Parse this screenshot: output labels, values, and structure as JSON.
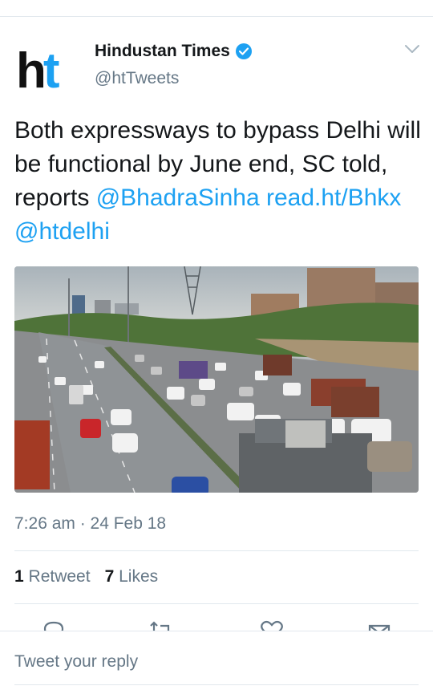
{
  "tweet": {
    "author": {
      "display_name": "Hindustan Times",
      "handle": "@htTweets",
      "avatar_text": "ht",
      "verified": true
    },
    "text_segments": [
      {
        "text": "Both expressways to bypass Delhi will be functional by June end, SC told, reports ",
        "link": false
      },
      {
        "text": "@BhadraSinha",
        "link": true
      },
      {
        "text": " ",
        "link": false
      },
      {
        "text": "read.ht/Bhkx",
        "link": true
      },
      {
        "text": " ",
        "link": false
      },
      {
        "text": "@htdelhi",
        "link": true
      }
    ],
    "timestamp": "7:26 am · 24 Feb 18",
    "retweets": {
      "count": "1",
      "label": "Retweet"
    },
    "likes": {
      "count": "7",
      "label": "Likes"
    }
  },
  "reply": {
    "placeholder": "Tweet your reply"
  },
  "colors": {
    "accent": "#1da1f2",
    "text": "#14171a",
    "muted": "#657786",
    "divider": "#e1e8ed"
  },
  "icons": [
    "verified-badge-icon",
    "chevron-down-icon",
    "reply-icon",
    "retweet-icon",
    "like-icon",
    "share-icon"
  ]
}
